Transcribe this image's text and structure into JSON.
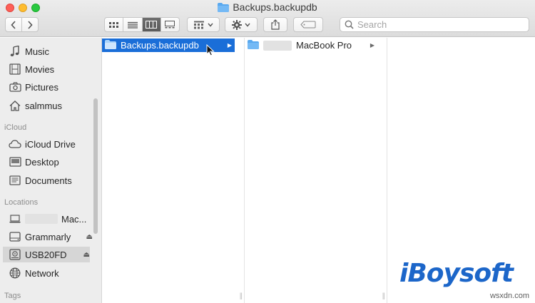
{
  "window": {
    "title": "Backups.backupdb"
  },
  "toolbar": {
    "search_placeholder": "Search",
    "view_modes": [
      "icon-view",
      "list-view",
      "column-view",
      "gallery-view"
    ],
    "active_view": "column-view"
  },
  "sidebar": {
    "favorites": [
      {
        "label": "Music",
        "icon": "music-note-icon"
      },
      {
        "label": "Movies",
        "icon": "film-icon"
      },
      {
        "label": "Pictures",
        "icon": "camera-icon"
      },
      {
        "label": "salmmus",
        "icon": "home-icon"
      }
    ],
    "icloud_heading": "iCloud",
    "icloud": [
      {
        "label": "iCloud Drive",
        "icon": "cloud-icon"
      },
      {
        "label": "Desktop",
        "icon": "desktop-icon"
      },
      {
        "label": "Documents",
        "icon": "document-icon"
      }
    ],
    "locations_heading": "Locations",
    "locations": [
      {
        "label": "Mac...",
        "icon": "laptop-icon"
      },
      {
        "label": "Grammarly",
        "icon": "drive-icon"
      },
      {
        "label": "USB20FD",
        "icon": "external-drive-icon"
      },
      {
        "label": "Network",
        "icon": "globe-icon"
      }
    ],
    "tags_heading": "Tags"
  },
  "columns": {
    "col1": [
      {
        "label": "Backups.backupdb",
        "selected": true
      }
    ],
    "col2": [
      {
        "label": "MacBook Pro",
        "selected": false
      }
    ]
  },
  "watermark": {
    "brand": "iBoysoft",
    "site": "wsxdn.com"
  },
  "colors": {
    "selection": "#1a6ed8",
    "folder": "#5aa9ef",
    "brand": "#1c66c9"
  }
}
